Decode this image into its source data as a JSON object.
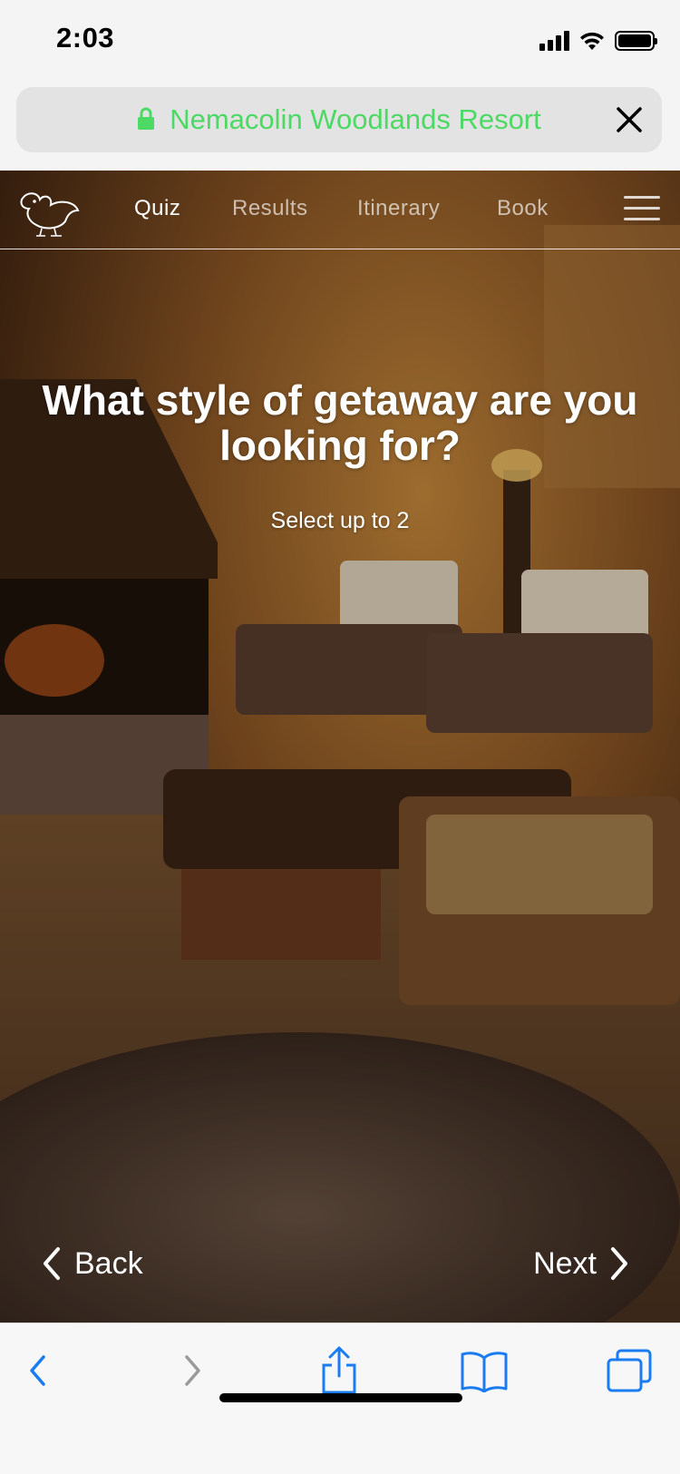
{
  "status": {
    "time": "2:03"
  },
  "browser": {
    "url_title": "Nemacolin Woodlands Resort",
    "accent_color": "#4cd964",
    "link_color": "#1a7cf0"
  },
  "nav": {
    "items": [
      {
        "label": "Quiz",
        "active": true
      },
      {
        "label": "Results",
        "active": false
      },
      {
        "label": "Itinerary",
        "active": false
      },
      {
        "label": "Book",
        "active": false
      }
    ]
  },
  "quiz": {
    "question": "What style of getaway are you looking for?",
    "hint": "Select up to 2",
    "back_label": "Back",
    "next_label": "Next"
  },
  "toolbar": {
    "icons": [
      "back-arrow-icon",
      "forward-arrow-icon",
      "share-icon",
      "bookmarks-icon",
      "tabs-icon"
    ]
  }
}
